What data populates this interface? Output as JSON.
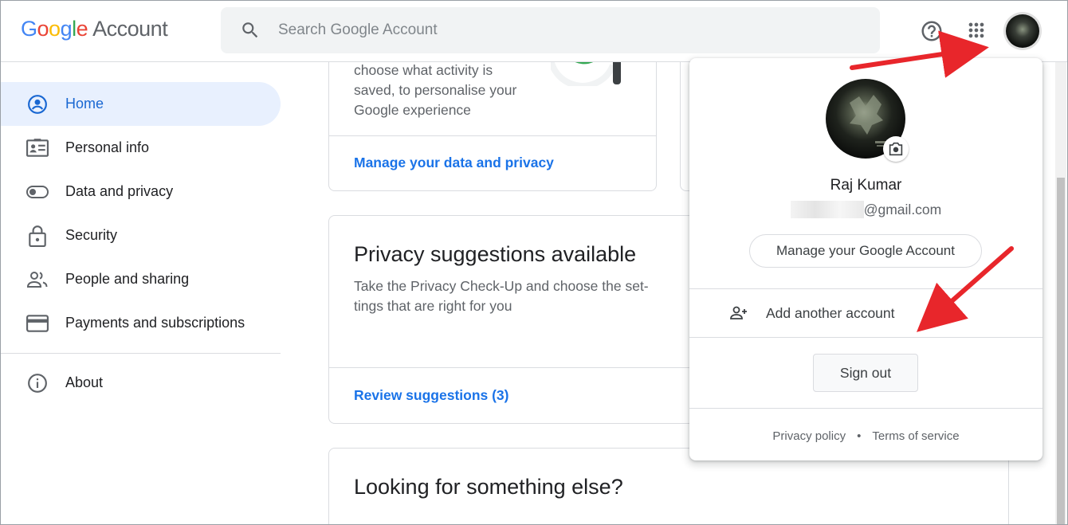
{
  "header": {
    "logo_google": [
      "G",
      "o",
      "o",
      "g",
      "l",
      "e"
    ],
    "logo_colors": [
      "#4285F4",
      "#EA4335",
      "#FBBC05",
      "#4285F4",
      "#34A853",
      "#EA4335"
    ],
    "logo_account": "Account",
    "search_placeholder": "Search Google Account",
    "help_icon": "help-icon",
    "apps_icon": "apps-grid-icon"
  },
  "sidebar": {
    "items": [
      {
        "label": "Home",
        "icon": "home-account-icon",
        "active": true
      },
      {
        "label": "Personal info",
        "icon": "id-card-icon"
      },
      {
        "label": "Data and privacy",
        "icon": "toggle-icon"
      },
      {
        "label": "Security",
        "icon": "lock-icon"
      },
      {
        "label": "People and sharing",
        "icon": "people-icon"
      },
      {
        "label": "Payments and subscriptions",
        "icon": "credit-card-icon"
      }
    ],
    "about": {
      "label": "About",
      "icon": "info-icon"
    }
  },
  "cards": {
    "data_privacy": {
      "desc_lines": [
        "choose what activity is",
        "saved, to personalise your",
        "Google experience"
      ],
      "link": "Manage your data and privacy"
    },
    "privacy_suggestions": {
      "title": "Privacy suggestions available",
      "desc_lines": [
        "Take the Privacy Check-Up and choose the set-",
        "tings that are right for you"
      ],
      "link": "Review suggestions (3)"
    },
    "looking": {
      "title": "Looking for something else?"
    }
  },
  "popup": {
    "name": "Raj Kumar",
    "email_suffix": "@gmail.com",
    "manage_button": "Manage your Google Account",
    "add_account": "Add another account",
    "sign_out": "Sign out",
    "privacy_policy": "Privacy policy",
    "separator": "•",
    "terms": "Terms of service"
  },
  "colors": {
    "accent_blue": "#1a73e8",
    "active_bg": "#e8f0fe",
    "arrow_red": "#e8262b"
  }
}
